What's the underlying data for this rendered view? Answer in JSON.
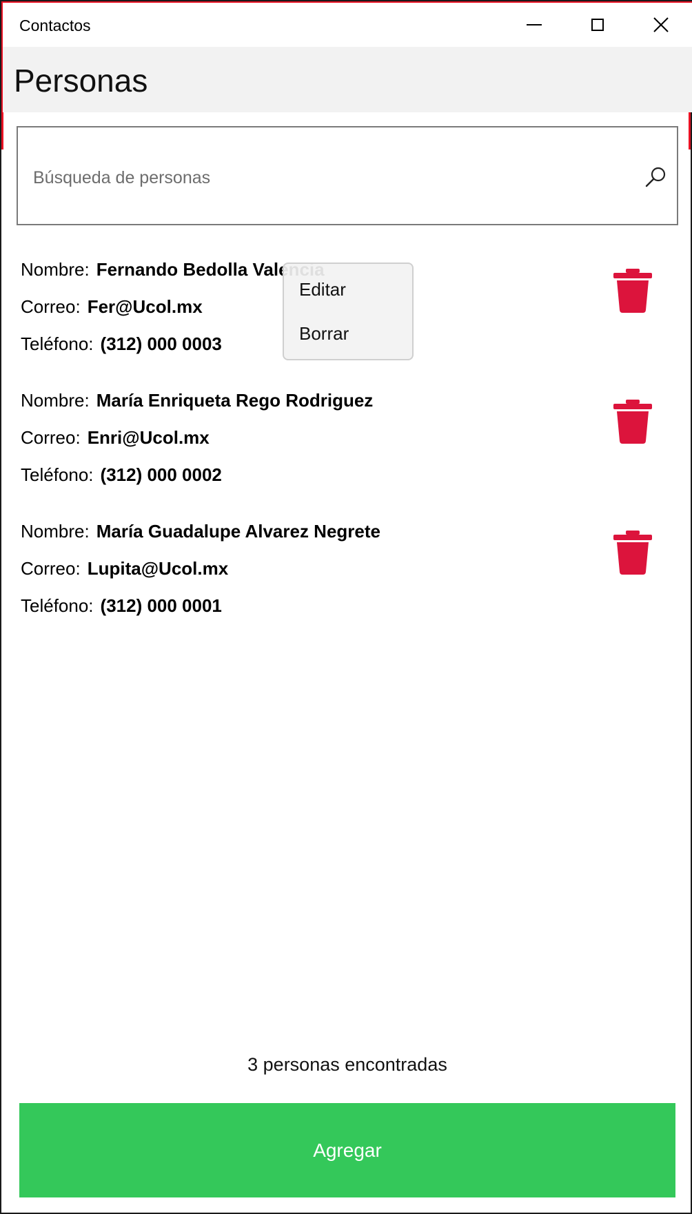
{
  "window": {
    "title": "Contactos",
    "controls": {
      "minimize": "minimize-icon",
      "maximize": "maximize-icon",
      "close": "close-icon"
    }
  },
  "header": {
    "title": "Personas"
  },
  "search": {
    "placeholder": "Búsqueda de personas",
    "value": "",
    "icon": "search-icon"
  },
  "labels": {
    "name": "Nombre:",
    "email": "Correo:",
    "phone": "Teléfono:"
  },
  "contacts": [
    {
      "name": "Fernando Bedolla Valencia",
      "email": "Fer@Ucol.mx",
      "phone": "(312) 000 0003"
    },
    {
      "name": "María Enriqueta Rego Rodriguez",
      "email": "Enri@Ucol.mx",
      "phone": "(312) 000 0002"
    },
    {
      "name": "María Guadalupe Alvarez Negrete",
      "email": "Lupita@Ucol.mx",
      "phone": "(312) 000 0001"
    }
  ],
  "context_menu": {
    "items": [
      "Editar",
      "Borrar"
    ]
  },
  "status": "3 personas encontradas",
  "add_button": {
    "label": "Agregar"
  },
  "colors": {
    "accent": "#e81123",
    "trash": "#dc143c",
    "add_button": "#34c85a",
    "header_bg": "#f2f2f2"
  }
}
